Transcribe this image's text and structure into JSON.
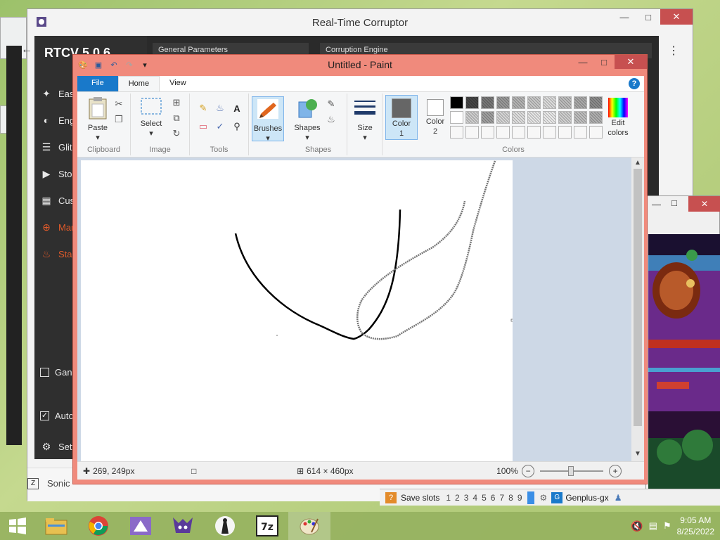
{
  "rtcv": {
    "window_title": "Real-Time Corruptor",
    "brand": "RTCV 5.0.6",
    "panel_general": "General Parameters",
    "panel_engine": "Corruption Engine",
    "sidebar": [
      {
        "label": "Easy",
        "icon": "wand-icon",
        "red": false
      },
      {
        "label": "Eng",
        "icon": "gauge-icon",
        "red": false
      },
      {
        "label": "Glitc",
        "icon": "layers-icon",
        "red": false
      },
      {
        "label": "Stoc",
        "icon": "play-icon",
        "red": false
      },
      {
        "label": "Cust",
        "icon": "grid-icon",
        "red": false
      },
      {
        "label": "Mar",
        "icon": "crosshair-icon",
        "red": true
      },
      {
        "label": "Star",
        "icon": "flame-icon",
        "red": true
      }
    ],
    "gam_label": "Gan",
    "auto_label": "Auto",
    "settings_label": "Sett",
    "footer_label": "Sonic"
  },
  "paint": {
    "title": "Untitled - Paint",
    "tabs": {
      "file": "File",
      "home": "Home",
      "view": "View"
    },
    "ribbon": {
      "paste": "Paste",
      "select": "Select",
      "brushes": "Brushes",
      "shapes": "Shapes",
      "size": "Size",
      "color1": "Color\n1",
      "color1_a": "Color",
      "color1_b": "1",
      "color2_a": "Color",
      "color2_b": "2",
      "edit_colors_a": "Edit",
      "edit_colors_b": "colors",
      "groups": {
        "clipboard": "Clipboard",
        "image": "Image",
        "tools": "Tools",
        "shapes": "Shapes",
        "colors": "Colors"
      }
    },
    "palette": [
      "#000000",
      "#464646",
      "#787878",
      "#9a9a9a",
      "#b4b4b4",
      "#c8c8c8",
      "#dcdcdc",
      "#bebebe",
      "#aaaaaa",
      "#8c8c8c",
      "#ffffff",
      "#cfcfcf",
      "#a0a0a0",
      "#d6d6d6",
      "#e0e0e0",
      "#e6e6e6",
      "#ebebeb",
      "#d0d0d0",
      "#c0c0c0",
      "#b0b0b0"
    ],
    "status": {
      "cursor": "269, 249px",
      "size": "614 × 460px",
      "zoom": "100%"
    }
  },
  "genplus": {
    "save_slots": "Save slots",
    "slots": [
      "1",
      "2",
      "3",
      "4",
      "5",
      "6",
      "7",
      "8",
      "9"
    ],
    "app_name": "Genplus-gx"
  },
  "taskbar": {
    "time": "9:05 AM",
    "date": "8/25/2022"
  }
}
